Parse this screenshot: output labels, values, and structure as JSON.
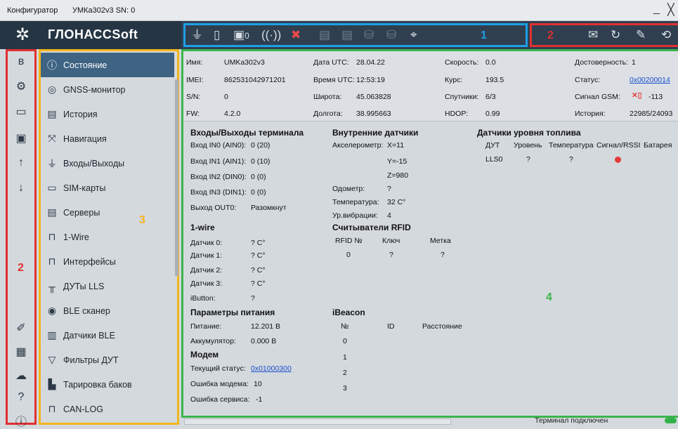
{
  "window": {
    "app_title": "Конфигуратор",
    "device_title": "УМКа302v3 SN: 0",
    "minimize": "_",
    "close": "╳"
  },
  "header": {
    "logo": "ГЛОНАССSoft",
    "toolbar_badge_text": "0",
    "toolbar_number": "1",
    "toolbar2_number": "2"
  },
  "sidebar": {
    "number": "2",
    "icons": [
      "bluetooth-icon",
      "usb-modem-icon",
      "folder-icon",
      "save-icon",
      "upload-icon",
      "download-icon",
      "script-icon",
      "calculator-icon",
      "cloud-icon",
      "help-icon",
      "info-icon"
    ]
  },
  "nav": {
    "number": "3",
    "items": [
      {
        "label": "Состояние",
        "icon": "info-icon"
      },
      {
        "label": "GNSS-монитор",
        "icon": "satellite-icon"
      },
      {
        "label": "История",
        "icon": "book-icon"
      },
      {
        "label": "Навигация",
        "icon": "navigation-icon"
      },
      {
        "label": "Входы/Выходы",
        "icon": "io-icon"
      },
      {
        "label": "SIM-карты",
        "icon": "sim-icon"
      },
      {
        "label": "Серверы",
        "icon": "server-icon"
      },
      {
        "label": "1-Wire",
        "icon": "plug-icon"
      },
      {
        "label": "Интерфейсы",
        "icon": "plug-icon"
      },
      {
        "label": "ДУТы LLS",
        "icon": "fuel-sensor-icon"
      },
      {
        "label": "BLE сканер",
        "icon": "ble-icon"
      },
      {
        "label": "Датчики BLE",
        "icon": "ble-sensor-icon"
      },
      {
        "label": "Фильтры ДУТ",
        "icon": "filter-icon"
      },
      {
        "label": "Тарировка баков",
        "icon": "tank-icon"
      },
      {
        "label": "CAN-LOG",
        "icon": "plug-icon"
      }
    ]
  },
  "info": {
    "name_label": "Имя:",
    "name": "UMKa302v3",
    "imei_label": "IMEI:",
    "imei": "862531042971201",
    "sn_label": "S/N:",
    "sn": "0",
    "fw_label": "FW:",
    "fw": "4.2.0",
    "date_label": "Дата UTC:",
    "date": "28.04.22",
    "time_label": "Время UTC:",
    "time": "12:53:19",
    "lat_label": "Широта:",
    "lat": "45.063828",
    "lon_label": "Долгота:",
    "lon": "38.995663",
    "speed_label": "Скорость:",
    "speed": "0.0",
    "course_label": "Курс:",
    "course": "193.5",
    "sats_label": "Спутники:",
    "sats": "6/3",
    "hdop_label": "HDOP:",
    "hdop": "0.99",
    "valid_label": "Достоверность:",
    "valid": "1",
    "status_label": "Статус:",
    "status": "0x00200014",
    "gsm_label": "Сигнал GSM:",
    "gsm": "-113",
    "history_label": "История:",
    "history": "22985/24093"
  },
  "io": {
    "title": "Входы/Выходы терминала",
    "rows": [
      {
        "label": "Вход IN0 (AIN0):",
        "value": "0 (20)"
      },
      {
        "label": "Вход IN1 (AIN1):",
        "value": "0 (10)"
      },
      {
        "label": "Вход IN2 (DIN0):",
        "value": "0 (0)"
      },
      {
        "label": "Вход IN3 (DIN1):",
        "value": "0 (0)"
      },
      {
        "label": "Выход OUT0:",
        "value": "Разомкнут"
      }
    ]
  },
  "onewire": {
    "title": "1-wire",
    "rows": [
      {
        "label": "Датчик 0:",
        "value": "? C°"
      },
      {
        "label": "Датчик 1:",
        "value": "? C°"
      },
      {
        "label": "Датчик 2:",
        "value": "? C°"
      },
      {
        "label": "Датчик 3:",
        "value": "? C°"
      },
      {
        "label": "iButton:",
        "value": "?"
      }
    ]
  },
  "power": {
    "title": "Параметры питания",
    "rows": [
      {
        "label": "Питание:",
        "value": "12.201 В"
      },
      {
        "label": "Аккумулятор:",
        "value": "0.000 В"
      }
    ]
  },
  "modem": {
    "title": "Модем",
    "status_label": "Текущий статус:",
    "status": "0x01000300",
    "err_label": "Ошибка модема:",
    "err": "10",
    "srv_label": "Ошибка сервиса:",
    "srv": "-1"
  },
  "internal": {
    "title": "Внутренние датчики",
    "accel_label": "Акселерометр:",
    "x": "X=11",
    "y": "Y=-15",
    "z": "Z=980",
    "odo_label": "Одометр:",
    "odo": "?",
    "temp_label": "Температура:",
    "temp": "32 C°",
    "vib_label": "Ур.вибрации:",
    "vib": "4"
  },
  "rfid": {
    "title": "Считыватели RFID",
    "cols": [
      "RFID №",
      "Ключ",
      "Метка"
    ],
    "row": [
      "0",
      "?",
      "?"
    ]
  },
  "ibeacon": {
    "title": "iBeacon",
    "cols": [
      "№",
      "ID",
      "Расстояние"
    ],
    "rows": [
      "0",
      "1",
      "2",
      "3"
    ]
  },
  "fuel": {
    "title": "Датчики уровня топлива",
    "cols": [
      "ДУТ",
      "Уровень",
      "Температура",
      "Сигнал/RSSI",
      "Батарея"
    ],
    "row": [
      "LLS0",
      "?",
      "?"
    ],
    "signal_color": "#e53b3b"
  },
  "main_number": "4",
  "statusbar": {
    "text": "Терминал подключен",
    "led_color": "#31b34a"
  },
  "colors": {
    "accent_blue": "#1e9fe8",
    "accent_red": "#e03030",
    "accent_yellow": "#f4b51c",
    "accent_green": "#3cb44b",
    "nav_active": "#3e6383"
  }
}
